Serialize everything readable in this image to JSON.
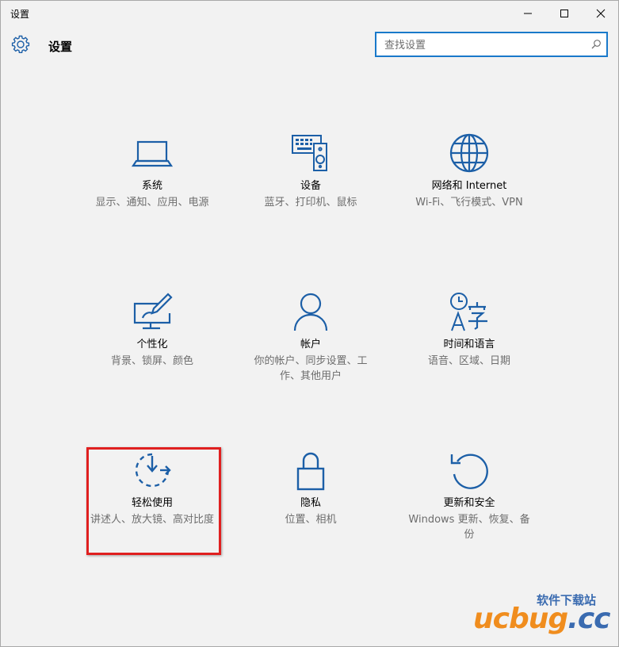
{
  "window": {
    "title": "设置"
  },
  "header": {
    "title": "设置"
  },
  "search": {
    "placeholder": "查找设置"
  },
  "colors": {
    "accent": "#1979ca",
    "icon": "#1c5fa7",
    "highlight": "#e02020",
    "desc": "#6d6d6d"
  },
  "tiles": [
    {
      "name": "系统",
      "desc": "显示、通知、应用、电源",
      "icon": "laptop-icon"
    },
    {
      "name": "设备",
      "desc": "蓝牙、打印机、鼠标",
      "icon": "devices-icon"
    },
    {
      "name": "网络和 Internet",
      "desc": "Wi-Fi、飞行模式、VPN",
      "icon": "globe-icon"
    },
    {
      "name": "个性化",
      "desc": "背景、锁屏、颜色",
      "icon": "personalization-icon"
    },
    {
      "name": "帐户",
      "desc": "你的帐户、同步设置、工作、其他用户",
      "icon": "person-icon"
    },
    {
      "name": "时间和语言",
      "desc": "语音、区域、日期",
      "icon": "time-language-icon"
    },
    {
      "name": "轻松使用",
      "desc": "讲述人、放大镜、高对比度",
      "icon": "ease-of-access-icon"
    },
    {
      "name": "隐私",
      "desc": "位置、相机",
      "icon": "lock-icon"
    },
    {
      "name": "更新和安全",
      "desc": "Windows 更新、恢复、备份",
      "icon": "refresh-icon"
    }
  ],
  "watermark": {
    "top": "软件下载站",
    "main": "ucbug",
    "suffix": ".cc"
  }
}
